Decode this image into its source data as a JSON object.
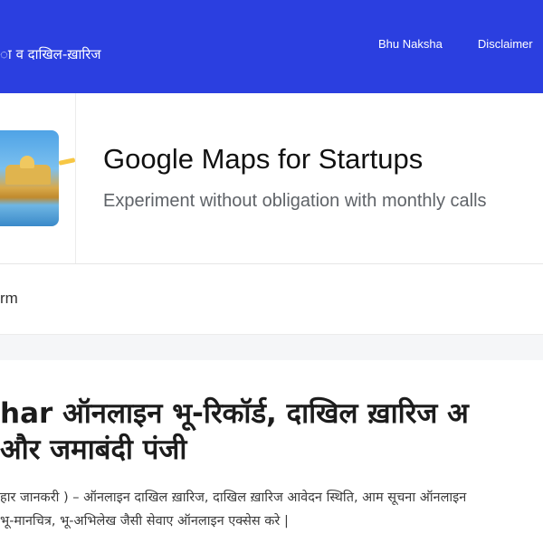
{
  "header": {
    "brand_partial": "ा व दाखिल-ख़ारिज",
    "nav": [
      "Bhu Naksha",
      "Disclaimer"
    ],
    "bg_color": "#2b3fe0"
  },
  "ad": {
    "title": "Google Maps for Startups",
    "subtitle": "Experiment without obligation with monthly calls",
    "image_icon": "golden-temple-photo"
  },
  "form_fragment": "rm",
  "article": {
    "title_line1": "har ऑनलाइन भू-रिकॉर्ड, दाखिल ख़ारिज अ",
    "title_line2": "और जमाबंदी पंजी",
    "body_line1": "हार जानकरी ) – ऑनलाइन दाखिल ख़ारिज, दाखिल ख़ारिज आवेदन स्थिति, आम सूचना ऑनलाइन",
    "body_line2": "भू-मानचित्र, भू-अभिलेख जैसी सेवाए ऑनलाइन एक्सेस करे |"
  }
}
